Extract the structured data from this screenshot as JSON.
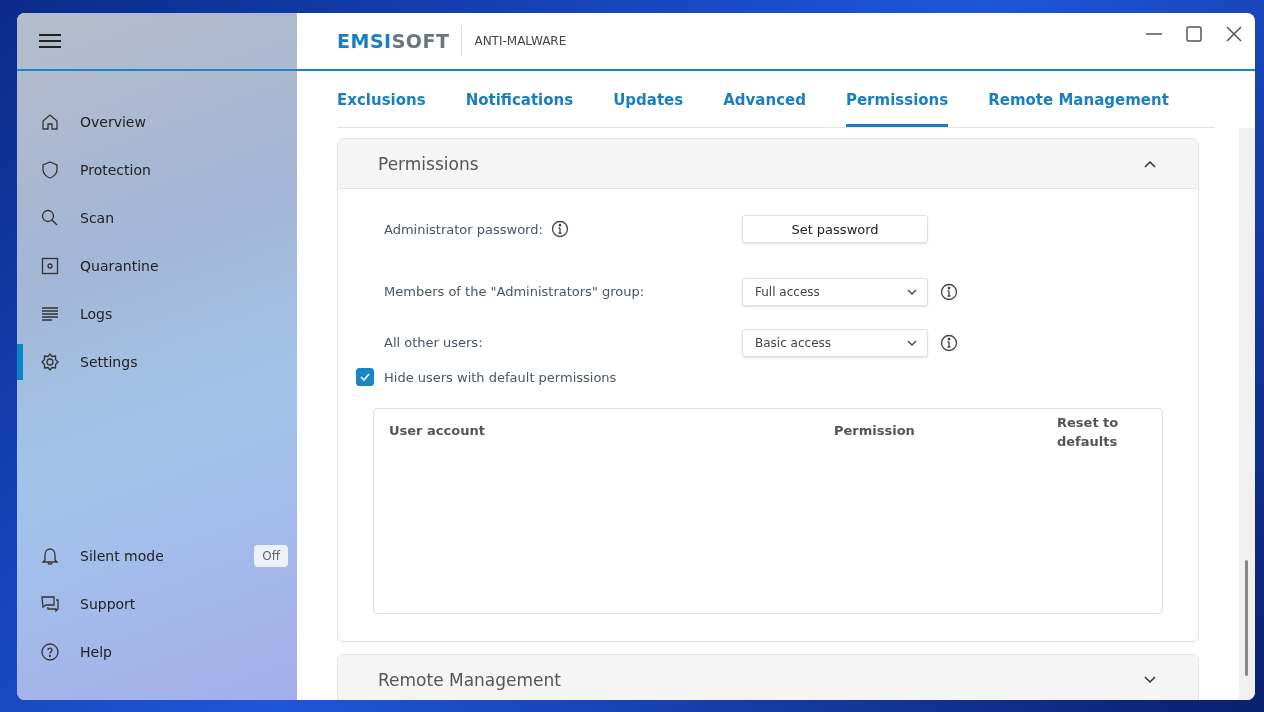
{
  "sidebar": {
    "items": [
      {
        "label": "Overview",
        "selected": false
      },
      {
        "label": "Protection",
        "selected": false
      },
      {
        "label": "Scan",
        "selected": false
      },
      {
        "label": "Quarantine",
        "selected": false
      },
      {
        "label": "Logs",
        "selected": false
      },
      {
        "label": "Settings",
        "selected": true
      }
    ],
    "bottom_items": [
      {
        "label": "Silent mode",
        "badge": "Off"
      },
      {
        "label": "Support"
      },
      {
        "label": "Help"
      }
    ]
  },
  "header": {
    "logo": [
      "EMSI",
      "SOFT"
    ],
    "product": "ANTI-MALWARE"
  },
  "tabs": [
    {
      "label": "Exclusions",
      "selected": false
    },
    {
      "label": "Notifications",
      "selected": false
    },
    {
      "label": "Updates",
      "selected": false
    },
    {
      "label": "Advanced",
      "selected": false
    },
    {
      "label": "Permissions",
      "selected": true
    },
    {
      "label": "Remote Management",
      "selected": false
    }
  ],
  "sections": [
    {
      "title": "Permissions",
      "expanded": true,
      "rows": [
        {
          "kind": "button",
          "label": "Administrator password:",
          "value": "Set password"
        },
        {
          "kind": "dropdown",
          "label": "Members of the \"Administrators\" group:",
          "value": "Full access"
        },
        {
          "kind": "dropdown",
          "label": "All other users:",
          "value": "Basic access"
        }
      ],
      "checkbox": {
        "label": "Hide users with default permissions",
        "checked": true
      },
      "table": {
        "columns": [
          "User account",
          "Permission",
          "Reset to defaults"
        ]
      }
    },
    {
      "title": "Remote Management",
      "expanded": false
    }
  ]
}
